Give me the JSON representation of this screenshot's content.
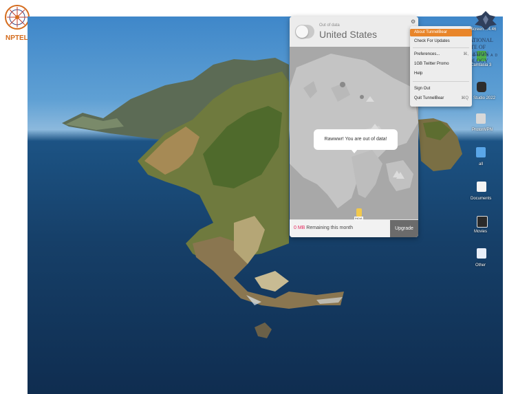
{
  "watermarks": {
    "left_logo_text": "NPTEL",
    "right_logo_line1": "INTERNATIONAL INSTITUTE OF",
    "right_logo_line2": "INFORMATION TECHNOLOGY",
    "right_logo_line3": "HYDERABAD"
  },
  "tunnelbear": {
    "status": "Out of data",
    "country": "United States",
    "message": "Rawwwr! You are out of data!",
    "data_amount": "0 MB",
    "data_suffix": " Remaining this month",
    "upgrade_label": "Upgrade",
    "map_pin_label": "INDIA",
    "colors": {
      "accent": "#e5265c",
      "menu_highlight": "#e8852a"
    }
  },
  "menu": {
    "items": [
      {
        "label": "About TunnelBear",
        "selected": true
      },
      {
        "label": "Check For Updates",
        "selected": false
      },
      {
        "label": "Preferences...",
        "shortcut": "⌘,",
        "selected": false
      },
      {
        "label": "1GB Twitter Promo",
        "selected": false
      },
      {
        "label": "Help",
        "selected": false
      },
      {
        "label": "Sign Out",
        "selected": false
      },
      {
        "label": "Quit TunnelBear",
        "shortcut": "⌘Q",
        "selected": false
      }
    ]
  },
  "desktop_icons": [
    {
      "label": "Screen ...4.46",
      "icon": "screenshot-icon"
    },
    {
      "label": "Camtasia 3",
      "icon": "camtasia-icon"
    },
    {
      "label": "Studio 2022",
      "icon": "studio-icon"
    },
    {
      "label": "ProtonVPN",
      "icon": "drive-icon"
    },
    {
      "label": "all",
      "icon": "folder-icon"
    },
    {
      "label": "Documents",
      "icon": "document-icon"
    },
    {
      "label": "Movies",
      "icon": "movies-icon"
    },
    {
      "label": "Other",
      "icon": "other-icon"
    }
  ]
}
